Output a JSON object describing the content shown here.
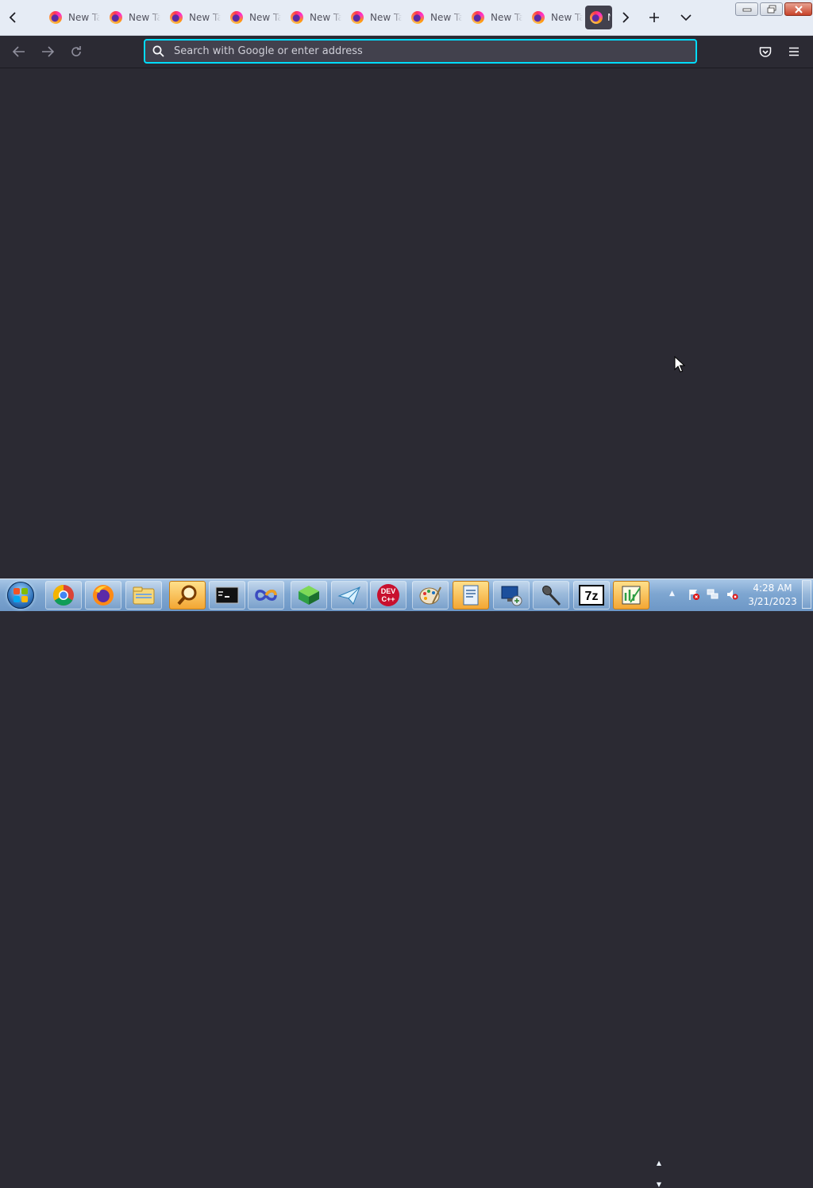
{
  "browser": {
    "tabs": [
      {
        "label": "New Tab"
      },
      {
        "label": "New Tab"
      },
      {
        "label": "New Tab"
      },
      {
        "label": "New Tab"
      },
      {
        "label": "New Tab"
      },
      {
        "label": "New Tab"
      },
      {
        "label": "New Tab"
      },
      {
        "label": "New Tab"
      },
      {
        "label": "New Tab"
      }
    ],
    "active_tab": {
      "label": "New Tab"
    },
    "urlbar": {
      "placeholder": "Search with Google or enter address"
    }
  },
  "taskbar": {
    "apps": [
      "start-menu",
      "google-chrome",
      "firefox",
      "file-explorer",
      "search-tool",
      "command-prompt",
      "infinity-app",
      "green-box-app",
      "paper-plane-app",
      "dev-cpp",
      "paint",
      "document-app",
      "remote-desktop",
      "microphone-app",
      "7-zip",
      "chart-editor"
    ],
    "clock": {
      "time": "4:28 AM",
      "date": "3/21/2023"
    }
  },
  "colors": {
    "page_bg": "#2b2a33",
    "tabstrip_bg": "#e6ecf5",
    "urlbar_bg": "#42414d",
    "focus_ring": "#00ddff",
    "taskbar_blue": "#7ea6d1"
  }
}
